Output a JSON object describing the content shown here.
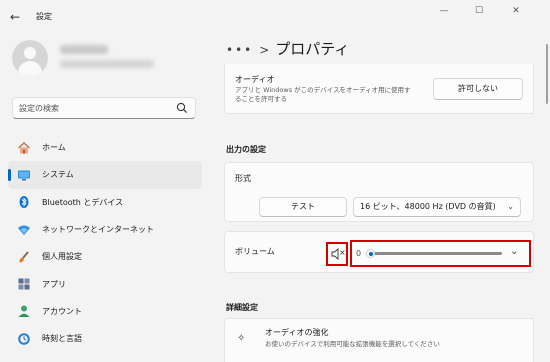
{
  "window": {
    "title": "設定",
    "back_glyph": "←",
    "min_glyph": "—",
    "max_glyph": "☐",
    "close_glyph": "✕"
  },
  "search": {
    "placeholder": "設定の検索",
    "icon": "search-icon"
  },
  "nav": [
    {
      "label": "ホーム",
      "icon": "home-icon",
      "selected": false
    },
    {
      "label": "システム",
      "icon": "monitor-icon",
      "selected": true
    },
    {
      "label": "Bluetooth とデバイス",
      "icon": "bluetooth-icon",
      "selected": false
    },
    {
      "label": "ネットワークとインターネット",
      "icon": "wifi-icon",
      "selected": false
    },
    {
      "label": "個人用設定",
      "icon": "brush-icon",
      "selected": false
    },
    {
      "label": "アプリ",
      "icon": "apps-icon",
      "selected": false
    },
    {
      "label": "アカウント",
      "icon": "account-icon",
      "selected": false
    },
    {
      "label": "時刻と言語",
      "icon": "clock-globe-icon",
      "selected": false
    }
  ],
  "breadcrumb": {
    "dots": "•••",
    "sep": ">",
    "current": "プロパティ"
  },
  "audio_card": {
    "title": "オーディオ",
    "desc_line1": "アプリと Windows がこのデバイスをオーディオ用に使用す",
    "desc_line2": "ることを許可する",
    "button": "許可しない"
  },
  "output": {
    "heading": "出力の設定",
    "format_label": "形式",
    "test_button": "テスト",
    "format_value": "16 ビット、48000 Hz (DVD の音質)",
    "chevron": "⌄"
  },
  "volume": {
    "label": "ボリューム",
    "mute_glyph": "×",
    "value": "0",
    "level": 0
  },
  "advanced": {
    "heading": "詳細設定",
    "enhance_title": "オーディオの強化",
    "enhance_desc": "お使いのデバイスで利用可能な拡張機能を選択してください"
  },
  "colors": {
    "accent": "#0067c0",
    "highlight": "#d40000",
    "background": "#f3f3f3",
    "card": "#fbfbfb"
  }
}
